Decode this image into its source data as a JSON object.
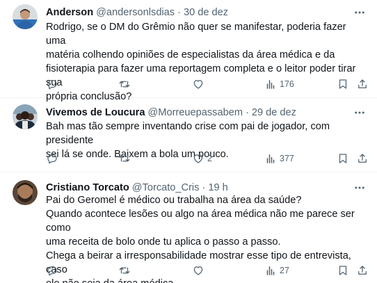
{
  "tweets": [
    {
      "name": "Anderson",
      "handle": "@andersonlsdias",
      "separator": "·",
      "time": "30 de dez",
      "lines": [
        "Rodrigo, se o DM do Grêmio não quer se manifestar, poderia fazer uma",
        "matéria colhendo opiniões de especialistas da área médica e da",
        "fisioterapia para fazer uma reportagem completa e o leitor poder tirar sua",
        "própria conclusão?"
      ],
      "replies": "",
      "retweets": "",
      "likes": "",
      "views": "176",
      "avatar_icon": "person-photo-icon"
    },
    {
      "name": "Vivemos de Loucura",
      "handle": "@Morreuepassabem",
      "separator": "·",
      "time": "29 de dez",
      "lines": [
        "Bah mas tão sempre inventando crise com pai de jogador, com presidente",
        "sei lá se onde. Baixem a bola um pouco."
      ],
      "replies": "",
      "retweets": "",
      "likes": "2",
      "views": "377",
      "avatar_icon": "group-photo-icon"
    },
    {
      "name": "Cristiano Torcato",
      "handle": "@Torcato_Cris",
      "separator": "·",
      "time": "19 h",
      "lines": [
        "Pai do Geromel é médico ou trabalha na área da saúde?",
        "Quando acontece lesões ou algo na área médica não me parece ser como",
        "uma receita de bolo onde tu aplica o passo a passo.",
        "Chega a beirar a irresponsabilidade mostrar esse tipo de entrevista, caso",
        "ele não seja da área médica."
      ],
      "replies": "",
      "retweets": "",
      "likes": "",
      "views": "27",
      "avatar_icon": "person-photo-icon"
    }
  ],
  "colors": {
    "text": "#0f1419",
    "muted": "#536471",
    "divider": "#eff3f4",
    "background": "#ffffff"
  }
}
